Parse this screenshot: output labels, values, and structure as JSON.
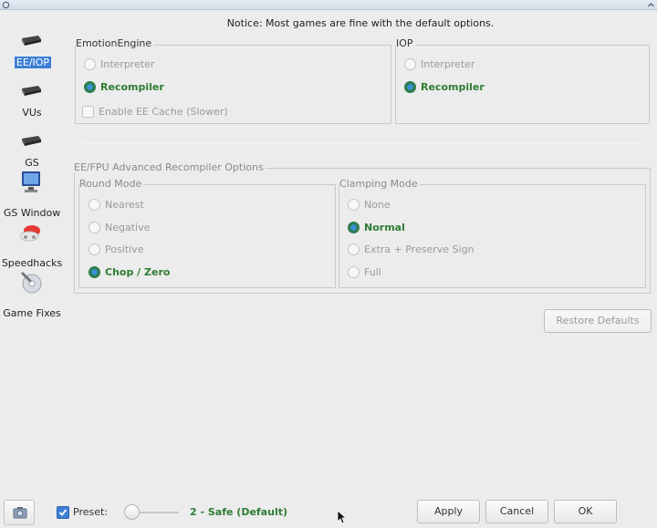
{
  "titlebar": {
    "left_icon": "app-menu-icon",
    "right_icon": "chevron-up-icon"
  },
  "nav": {
    "items": [
      {
        "label": "EE/IOP",
        "icon": "chip-icon",
        "selected": true
      },
      {
        "label": "VUs",
        "icon": "chip-icon",
        "selected": false
      },
      {
        "label": "GS",
        "icon": "chip-icon",
        "selected": false
      },
      {
        "label": "GS Window",
        "icon": "monitor-icon",
        "selected": false
      },
      {
        "label": "Speedhacks",
        "icon": "speedhacks-icon",
        "selected": false
      },
      {
        "label": "Game Fixes",
        "icon": "game-fixes-icon",
        "selected": false
      }
    ]
  },
  "notice": "Notice: Most games are fine with the default options.",
  "emotion_engine": {
    "title": "EmotionEngine",
    "options": [
      {
        "label": "Interpreter",
        "selected": false
      },
      {
        "label": "Recompiler",
        "selected": true
      }
    ],
    "cache_label": "Enable EE Cache (Slower)"
  },
  "iop": {
    "title": "IOP",
    "options": [
      {
        "label": "Interpreter",
        "selected": false
      },
      {
        "label": "Recompiler",
        "selected": true
      }
    ]
  },
  "advanced": {
    "title": "EE/FPU Advanced Recompiler Options",
    "round_mode": {
      "title": "Round Mode",
      "options": [
        {
          "label": "Nearest",
          "selected": false
        },
        {
          "label": "Negative",
          "selected": false
        },
        {
          "label": "Positive",
          "selected": false
        },
        {
          "label": "Chop / Zero",
          "selected": true
        }
      ]
    },
    "clamping_mode": {
      "title": "Clamping Mode",
      "options": [
        {
          "label": "None",
          "selected": false
        },
        {
          "label": "Normal",
          "selected": true
        },
        {
          "label": "Extra + Preserve Sign",
          "selected": false
        },
        {
          "label": "Full",
          "selected": false
        }
      ]
    },
    "restore_defaults": "Restore Defaults"
  },
  "bottom": {
    "preset_label": "Preset:",
    "preset_checked": true,
    "preset_value": "2 - Safe (Default)",
    "apply": "Apply",
    "cancel": "Cancel",
    "ok": "OK"
  },
  "colors": {
    "accent": "#3d7fd6",
    "selected_text": "#2e7d32"
  }
}
